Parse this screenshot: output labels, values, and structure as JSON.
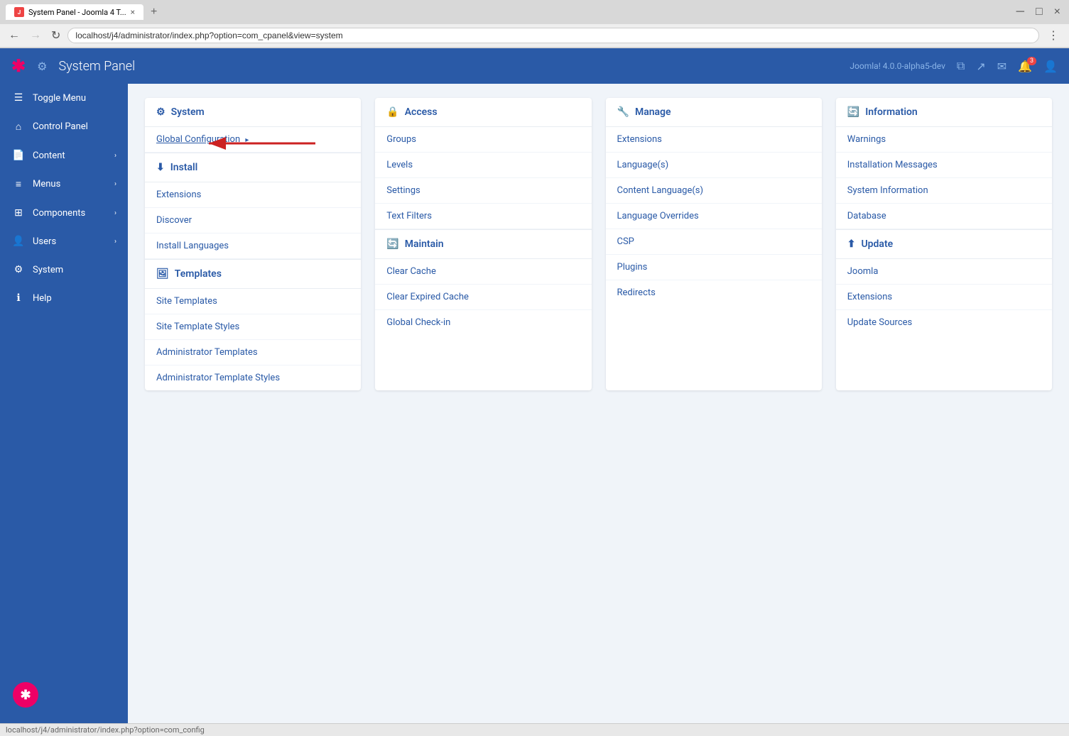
{
  "browser": {
    "tab_title": "System Panel - Joomla 4 T...",
    "tab_favicon": "J",
    "address_bar": "localhost/j4/administrator/index.php?option=com_cpanel&view=system",
    "status_bar": "localhost/j4/administrator/index.php?option=com_config"
  },
  "top_bar": {
    "title": "System Panel",
    "version": "Joomla! 4.0.0-alpha5-dev"
  },
  "sidebar": {
    "items": [
      {
        "icon": "☰",
        "label": "Toggle Menu"
      },
      {
        "icon": "⌂",
        "label": "Control Panel"
      },
      {
        "icon": "📄",
        "label": "Content",
        "has_arrow": true
      },
      {
        "icon": "☰",
        "label": "Menus",
        "has_arrow": true
      },
      {
        "icon": "⊞",
        "label": "Components",
        "has_arrow": true
      },
      {
        "icon": "👤",
        "label": "Users",
        "has_arrow": true
      },
      {
        "icon": "⚙",
        "label": "System"
      },
      {
        "icon": "ℹ",
        "label": "Help"
      }
    ]
  },
  "panels": {
    "system": {
      "header": "System",
      "items": [
        {
          "label": "Global Configuration"
        }
      ],
      "install": {
        "header": "Install",
        "items": [
          {
            "label": "Extensions"
          },
          {
            "label": "Discover"
          },
          {
            "label": "Install Languages"
          }
        ]
      },
      "templates": {
        "header": "Templates",
        "items": [
          {
            "label": "Site Templates"
          },
          {
            "label": "Site Template Styles"
          },
          {
            "label": "Administrator Templates"
          },
          {
            "label": "Administrator Template Styles"
          }
        ]
      }
    },
    "access": {
      "header": "Access",
      "items": [
        {
          "label": "Groups"
        },
        {
          "label": "Levels"
        },
        {
          "label": "Settings"
        },
        {
          "label": "Text Filters"
        }
      ],
      "maintain": {
        "header": "Maintain",
        "items": [
          {
            "label": "Clear Cache"
          },
          {
            "label": "Clear Expired Cache"
          },
          {
            "label": "Global Check-in"
          }
        ]
      }
    },
    "manage": {
      "header": "Manage",
      "items": [
        {
          "label": "Extensions"
        },
        {
          "label": "Language(s)"
        },
        {
          "label": "Content Language(s)"
        },
        {
          "label": "Language Overrides"
        },
        {
          "label": "CSP"
        },
        {
          "label": "Plugins"
        },
        {
          "label": "Redirects"
        }
      ]
    },
    "information": {
      "header": "Information",
      "items": [
        {
          "label": "Warnings"
        },
        {
          "label": "Installation Messages"
        },
        {
          "label": "System Information"
        },
        {
          "label": "Database"
        }
      ],
      "update": {
        "header": "Update",
        "items": [
          {
            "label": "Joomla"
          },
          {
            "label": "Extensions"
          },
          {
            "label": "Update Sources"
          }
        ]
      }
    }
  },
  "icons": {
    "gear": "⚙",
    "lock": "🔒",
    "manage": "🔧",
    "info": "ℹ",
    "install": "⬇",
    "templates": "🖼",
    "maintain": "🔄",
    "update": "⬆",
    "bell": "🔔",
    "mail": "✉",
    "user": "👤",
    "external": "↗",
    "copy": "⧉"
  }
}
